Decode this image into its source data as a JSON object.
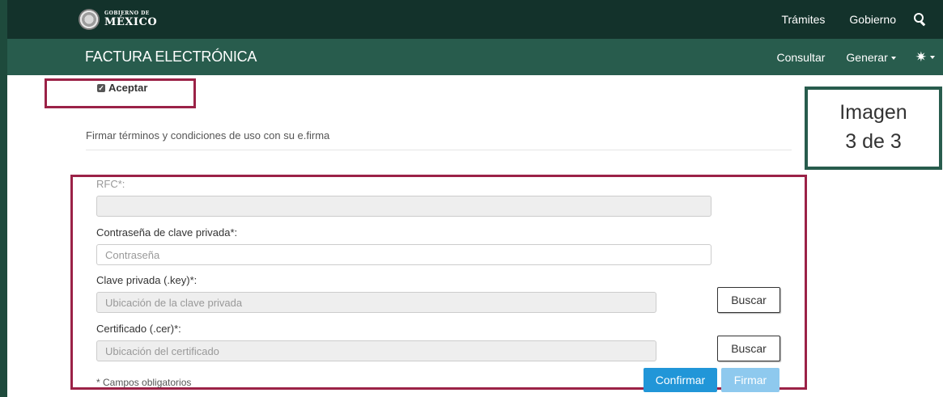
{
  "header": {
    "logo_small": "GOBIERNO DE",
    "logo_big": "MÉXICO",
    "links": [
      "Trámites",
      "Gobierno"
    ],
    "search_icon": "search-icon"
  },
  "app": {
    "title": "FACTURA ELECTRÓNICA",
    "menu": [
      "Consultar",
      "Generar"
    ],
    "settings_icon": "gear-icon"
  },
  "accept": {
    "checked": true,
    "label": "Aceptar"
  },
  "section_title": "Firmar términos y condiciones de uso con su e.firma",
  "callout": {
    "line1": "Imagen",
    "line2": "3 de 3"
  },
  "form": {
    "rfc_label": "RFC*:",
    "rfc_value": "",
    "password_label": "Contraseña de clave privada*:",
    "password_placeholder": "Contraseña",
    "key_label": "Clave privada (.key)*:",
    "key_placeholder": "Ubicación de la clave privada",
    "cert_label": "Certificado (.cer)*:",
    "cert_placeholder": "Ubicación del certificado",
    "browse_label": "Buscar",
    "required_note": "* Campos obligatorios",
    "confirm_label": "Confirmar",
    "sign_label": "Firmar"
  },
  "colors": {
    "gov_bar": "#13322b",
    "app_bar": "#285c4d",
    "highlight": "#9b2247",
    "primary": "#2196d8"
  }
}
